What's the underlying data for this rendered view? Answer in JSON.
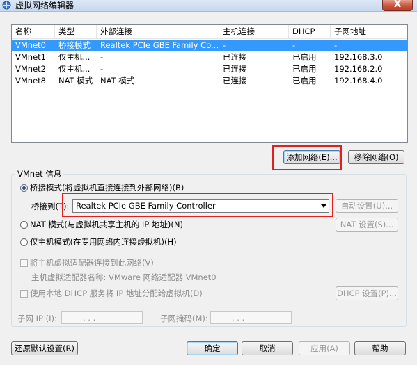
{
  "window": {
    "title": "虚拟网络编辑器",
    "close_glyph": "X",
    "icon": "network-icon"
  },
  "network_list": {
    "columns": [
      "名称",
      "类型",
      "外部连接",
      "主机连接",
      "DHCP",
      "子网地址"
    ],
    "rows": [
      [
        "VMnet0",
        "桥接模式",
        "Realtek PCIe GBE Family Co...",
        "-",
        "-",
        "-"
      ],
      [
        "VMnet1",
        "仅主机...",
        "-",
        "已连接",
        "已启用",
        "192.168.3.0"
      ],
      [
        "VMnet2",
        "仅主机...",
        "-",
        "已连接",
        "已启用",
        "192.168.2.0"
      ],
      [
        "VMnet8",
        "NAT 模式",
        "NAT 模式",
        "已连接",
        "已启用",
        "192.168.4.0"
      ]
    ],
    "selected_row": 0
  },
  "list_buttons": {
    "add_network": "添加网络(E)...",
    "remove_network": "移除网络(O)"
  },
  "vmnet_info": {
    "group_title": "VMnet 信息",
    "bridged_label": "桥接模式(将虚拟机直接连接到外部网络)(B)",
    "bridged_to_label": "桥接到(T):",
    "bridged_to_value": "Realtek PCIe GBE Family Controller",
    "auto_settings": "自动设置(U)...",
    "nat_label": "NAT 模式(与虚拟机共享主机的 IP 地址)(N)",
    "nat_settings": "NAT 设置(S)...",
    "hostonly_label": "仅主机模式(在专用网络内连接虚拟机)(H)",
    "connect_adapter_label": "将主机虚拟适配器连接到此网络(V)",
    "adapter_name_label": "主机虚拟适配器名称: VMware 网络适配器 VMnet0",
    "dhcp_label": "使用本地 DHCP 服务将 IP 地址分配给虚拟机(D)",
    "dhcp_settings": "DHCP 设置(P)...",
    "subnet_ip_label": "子网 IP (I):",
    "subnet_mask_label": "子网掩码(M):",
    "ip_placeholder": ". . ."
  },
  "footer": {
    "restore_defaults": "还原默认设置(R)",
    "ok": "确定",
    "cancel": "取消",
    "apply": "应用(A)",
    "help": "帮助"
  }
}
